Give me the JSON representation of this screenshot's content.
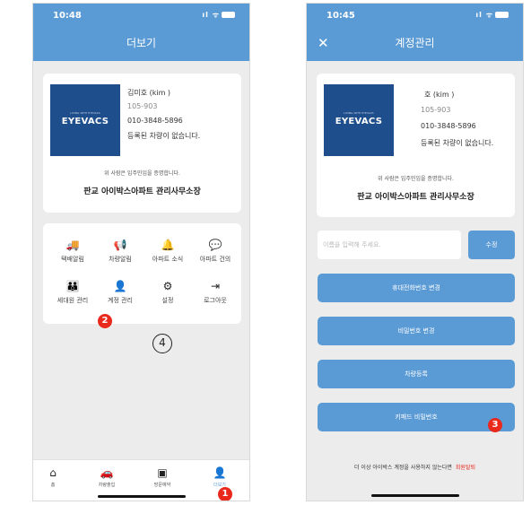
{
  "status": {
    "left_time": "10:48",
    "right_time": "10:45",
    "signal": "ıl ᯤ"
  },
  "left": {
    "title": "더보기",
    "id_card": {
      "logo_tagline": "LIVING WITH EYEVACS",
      "logo_text": "EYEVACS",
      "name": "김미호 (kim           )",
      "unit": "105-903",
      "phone": "010-3848-5896",
      "no_vehicle": "등록된 차량이 없습니다.",
      "note": "위 사람은 입주민임을 증명합니다.",
      "office": "판교 아이박스아파트 관리사무소장"
    },
    "menu": [
      {
        "icon": "🚚",
        "label": "택배알림"
      },
      {
        "icon": "📢",
        "label": "차량알림"
      },
      {
        "icon": "🔔",
        "label": "아파트 소식"
      },
      {
        "icon": "💬",
        "label": "아파트 건의"
      },
      {
        "icon": "👪",
        "label": "세대원 관리"
      },
      {
        "icon": "👤",
        "label": "계정 관리"
      },
      {
        "icon": "⚙",
        "label": "설정"
      },
      {
        "icon": "⇥",
        "label": "로그아웃"
      }
    ],
    "tabs": [
      {
        "icon": "⌂",
        "label": "홈"
      },
      {
        "icon": "🚗",
        "label": "차량출입"
      },
      {
        "icon": "▣",
        "label": "방문예약"
      },
      {
        "icon": "👤",
        "label": "더보기"
      }
    ],
    "markers": {
      "one": "1",
      "two": "2",
      "four": "4"
    }
  },
  "right": {
    "title": "계정관리",
    "close": "✕",
    "id_card": {
      "logo_tagline": "LIVING WITH EYEVACS",
      "logo_text": "EYEVACS",
      "name": "호 (kim           )",
      "unit": "105-903",
      "phone": "010-3848-5896",
      "no_vehicle": "등록된 차량이 없습니다.",
      "note": "위 사람은 입주민임을 증명합니다.",
      "office": "판교 아이박스아파트 관리사무소장"
    },
    "name_placeholder": "이름을 입력해 주세요.",
    "edit_label": "수정",
    "buttons": [
      "휴대전화번호 변경",
      "비밀번호 변경",
      "차량등록",
      "키패드 비밀번호"
    ],
    "withdraw_text": "더 이상 아이박스 계정을 사용하지 않는다면",
    "withdraw_link": "회원탈퇴",
    "markers": {
      "three": "3"
    }
  },
  "colors": {
    "accent": "#5b9bd5",
    "marker": "#e8291c",
    "card": "#1f4e8c"
  }
}
